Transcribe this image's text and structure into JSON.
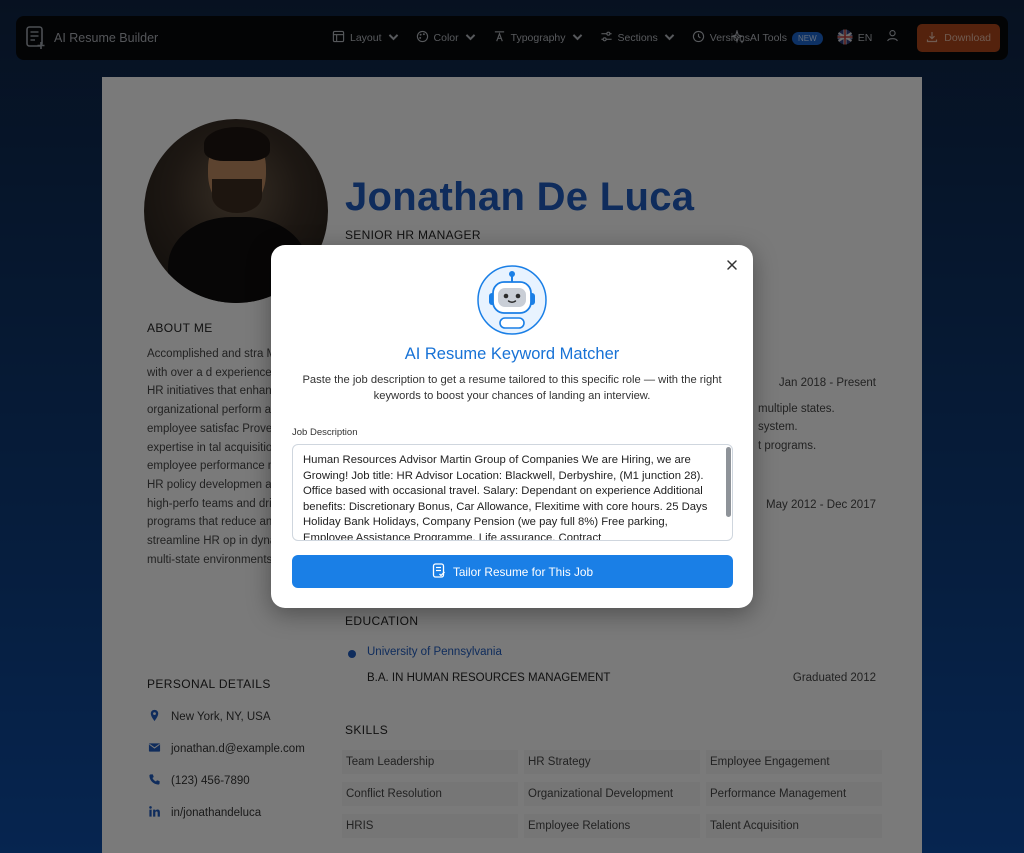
{
  "topbar": {
    "brand": "AI Resume Builder",
    "nav": [
      {
        "label": "Layout",
        "icon": "layout-icon",
        "has_menu": true
      },
      {
        "label": "Color",
        "icon": "palette-icon",
        "has_menu": true
      },
      {
        "label": "Typography",
        "icon": "typography-icon",
        "has_menu": true
      },
      {
        "label": "Sections",
        "icon": "sections-icon",
        "has_menu": true
      },
      {
        "label": "Versions",
        "icon": "clock-icon",
        "has_menu": false
      }
    ],
    "ai_tools": "AI Tools",
    "ai_badge": "NEW",
    "language": "EN",
    "download": "Download"
  },
  "resume": {
    "name": "Jonathan De Luca",
    "role": "SENIOR HR MANAGER",
    "about_title": "ABOUT ME",
    "about_text": "Accomplished and stra Manager with over a d experience leading HR initiatives that enhanc organizational perform and employee satisfac Proven expertise in tal acquisition, employee performance managen HR policy developmen at building high-perfo teams and driving inno programs that reduce and streamline HR op in dynamic, multi-state environments.",
    "personal_title": "PERSONAL DETAILS",
    "details": {
      "location": "New York, NY, USA",
      "email": "jonathan.d@example.com",
      "phone": "(123) 456-7890",
      "linkedin": "in/jonathandeluca"
    },
    "experience": {
      "date1": "Jan 2018 - Present",
      "line1": "multiple states.",
      "line2": "system.",
      "line3": "t programs.",
      "date2": "May 2012 - Dec 2017"
    },
    "education_title": "EDUCATION",
    "education": {
      "school": "University of Pennsylvania",
      "degree": "B.A. IN HUMAN RESOURCES MANAGEMENT",
      "year": "Graduated 2012"
    },
    "skills_title": "SKILLS",
    "skills": [
      "Team Leadership",
      "HR Strategy",
      "Employee Engagement",
      "Conflict Resolution",
      "Organizational Development",
      "Performance Management",
      "HRIS",
      "Employee Relations",
      "Talent Acquisition"
    ]
  },
  "modal": {
    "title": "AI Resume Keyword Matcher",
    "description": "Paste the job description to get a resume tailored to this specific role — with the right keywords to boost your chances of landing an interview.",
    "field_label": "Job Description",
    "job_description": "Human Resources Advisor Martin Group of Companies We are Hiring, we are Growing! Job title: HR Advisor Location: Blackwell, Derbyshire, (M1 junction 28). Office based with occasional travel. Salary: Dependant on experience Additional benefits: Discretionary Bonus, Car Allowance, Flexitime with core hours. 25 Days Holiday  Bank Holidays, Company Pension (we pay full 8%) Free parking, Employee Assistance Programme, Life assurance, Contract",
    "button": "Tailor Resume for This Job"
  },
  "colors": {
    "accent": "#1a7fe6",
    "name": "#1e58b8",
    "download": "#a8441a",
    "badge": "#1b62c9"
  }
}
